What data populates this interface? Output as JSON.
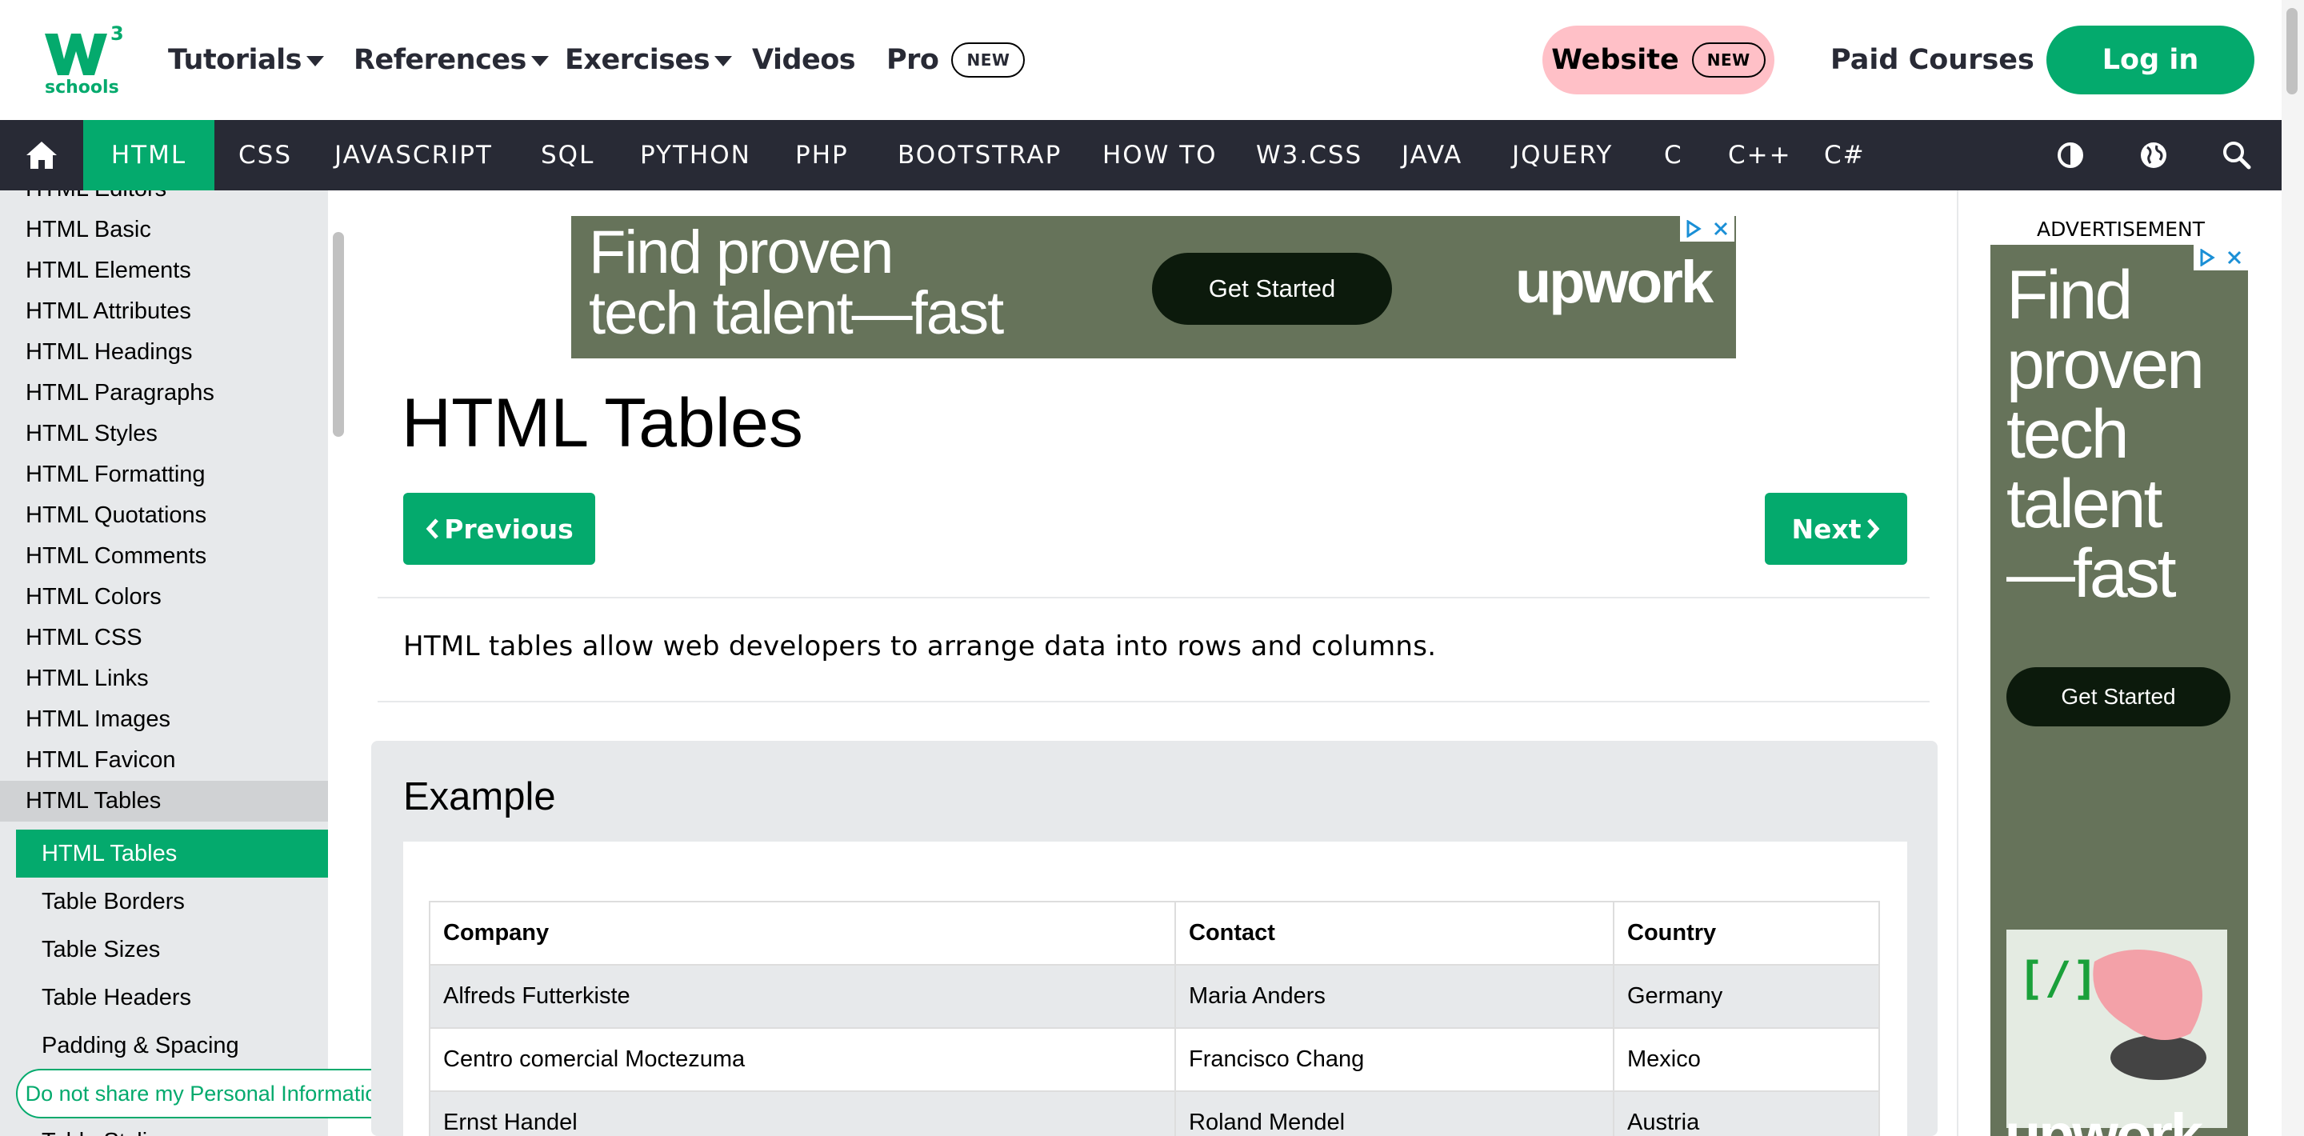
{
  "topbar": {
    "logo_text": "schools",
    "logo_sup": "3",
    "menu": [
      {
        "label": "Tutorials"
      },
      {
        "label": "References"
      },
      {
        "label": "Exercises"
      },
      {
        "label": "Videos"
      },
      {
        "label": "Pro",
        "badge": "NEW"
      }
    ],
    "website_label": "Website",
    "website_badge": "NEW",
    "paid_courses": "Paid Courses",
    "login": "Log in"
  },
  "topics": [
    "HTML",
    "CSS",
    "JAVASCRIPT",
    "SQL",
    "PYTHON",
    "PHP",
    "BOOTSTRAP",
    "HOW TO",
    "W3.CSS",
    "JAVA",
    "JQUERY",
    "C",
    "C++",
    "C#"
  ],
  "nav_icons": [
    "home-icon",
    "contrast-icon",
    "globe-icon",
    "search-icon"
  ],
  "sidebar": {
    "links": [
      "HTML Editors",
      "HTML Basic",
      "HTML Elements",
      "HTML Attributes",
      "HTML Headings",
      "HTML Paragraphs",
      "HTML Styles",
      "HTML Formatting",
      "HTML Quotations",
      "HTML Comments",
      "HTML Colors",
      "HTML CSS",
      "HTML Links",
      "HTML Images",
      "HTML Favicon",
      "HTML Tables"
    ],
    "sub_links": [
      "HTML Tables",
      "Table Borders",
      "Table Sizes",
      "Table Headers",
      "Padding & Spacing",
      "Table Styling"
    ],
    "privacy": "Do not share my Personal Information"
  },
  "ad_banner": {
    "headline_1": "Find proven",
    "headline_2": "tech talent—fast",
    "cta": "Get Started",
    "brand": "upwork"
  },
  "main": {
    "title": "HTML Tables",
    "prev": "Previous",
    "next": "Next",
    "intro": "HTML tables allow web developers to arrange data into rows and columns.",
    "example_title": "Example",
    "table": {
      "headers": [
        "Company",
        "Contact",
        "Country"
      ],
      "rows": [
        [
          "Alfreds Futterkiste",
          "Maria Anders",
          "Germany"
        ],
        [
          "Centro comercial Moctezuma",
          "Francisco Chang",
          "Mexico"
        ],
        [
          "Ernst Handel",
          "Roland Mendel",
          "Austria"
        ]
      ]
    }
  },
  "right_ad": {
    "label": "ADVERTISEMENT",
    "headline": [
      "Find",
      "proven",
      "tech",
      "talent",
      "—fast"
    ],
    "cta": "Get Started",
    "brand": "upwork"
  },
  "colors": {
    "brand_green": "#04aa6d",
    "dark_nav": "#282a35",
    "pink": "#ffc0c7",
    "sidebar_bg": "#e7e9eb",
    "ad_bg": "#66735a"
  }
}
